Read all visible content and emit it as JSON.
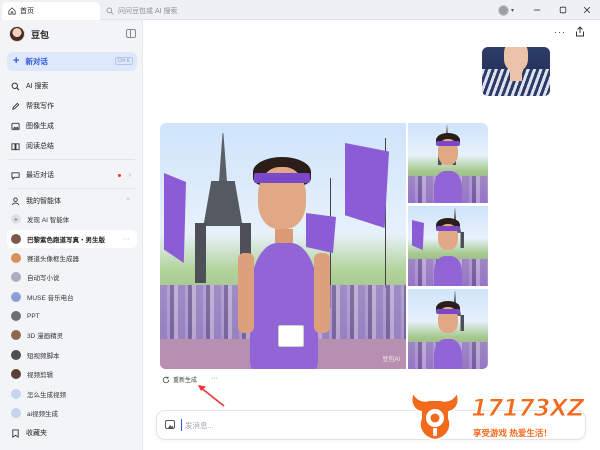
{
  "tab": {
    "label": "首页"
  },
  "address": {
    "text": "问问豆包或 AI 搜索"
  },
  "sidebar": {
    "brand": "豆包",
    "new_chat": {
      "label": "新对话",
      "shortcut": "Ctrl K"
    },
    "nav": [
      {
        "label": "AI 搜索",
        "icon": "search-icon"
      },
      {
        "label": "帮我写作",
        "icon": "pen-icon"
      },
      {
        "label": "图像生成",
        "icon": "image-icon"
      },
      {
        "label": "阅读总结",
        "icon": "book-icon"
      }
    ],
    "recent": {
      "label": "最近对话"
    },
    "agents": {
      "label": "我的智能体"
    },
    "agent_items": [
      {
        "label": "发现 AI 智能体",
        "color": "#c9ccd3"
      },
      {
        "label": "巴黎紫色跑道写真・男生版",
        "color": "#7a5a4a",
        "active": true
      },
      {
        "label": "赛道头像框生成器",
        "color": "#d9905e"
      },
      {
        "label": "自动写小说",
        "color": "#a7b0c0"
      },
      {
        "label": "MUSE 音乐电台",
        "color": "#8e9fd8"
      },
      {
        "label": "PPT",
        "color": "#6b6f77"
      },
      {
        "label": "3D 漫画精灵",
        "color": "#8b6a55"
      },
      {
        "label": "短视频脚本",
        "color": "#4f4f4f"
      },
      {
        "label": "视频剪辑",
        "color": "#5a4038"
      },
      {
        "label": "怎么生成视频",
        "color": "#c8d3ee"
      },
      {
        "label": "ai视频生成",
        "color": "#c8d3ee"
      }
    ],
    "favorites": {
      "label": "收藏夹"
    }
  },
  "main": {
    "image_watermark": "豆包AI",
    "regenerate_label": "重新生成",
    "input_placeholder": "发消息..."
  },
  "site_logo": {
    "number": "17173XZ",
    "slogan": "享受游戏 热爱生活！"
  }
}
